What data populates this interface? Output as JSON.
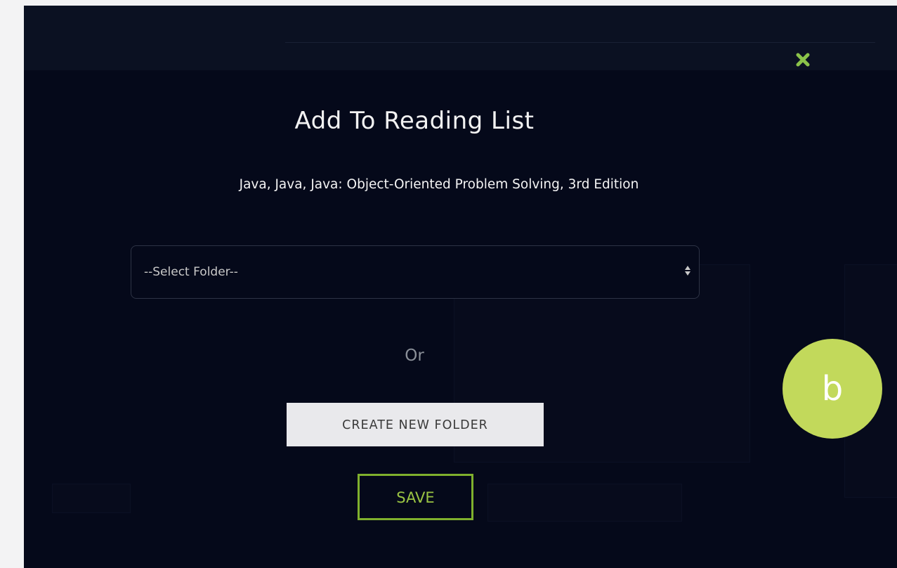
{
  "modal": {
    "title": "Add To Reading List",
    "book_title": "Java, Java, Java: Object-Oriented Problem Solving, 3rd Edition",
    "folder_select": {
      "selected": "--Select Folder--"
    },
    "or_label": "Or",
    "create_folder_label": "CREATE NEW FOLDER",
    "save_label": "SAVE",
    "close_icon": "close-x-icon"
  },
  "annotation": {
    "badge_label": "b"
  },
  "colors": {
    "background": "#05091a",
    "accent": "#7fb02d",
    "close_icon": "#8bc34a",
    "badge": "#c2d95b"
  }
}
